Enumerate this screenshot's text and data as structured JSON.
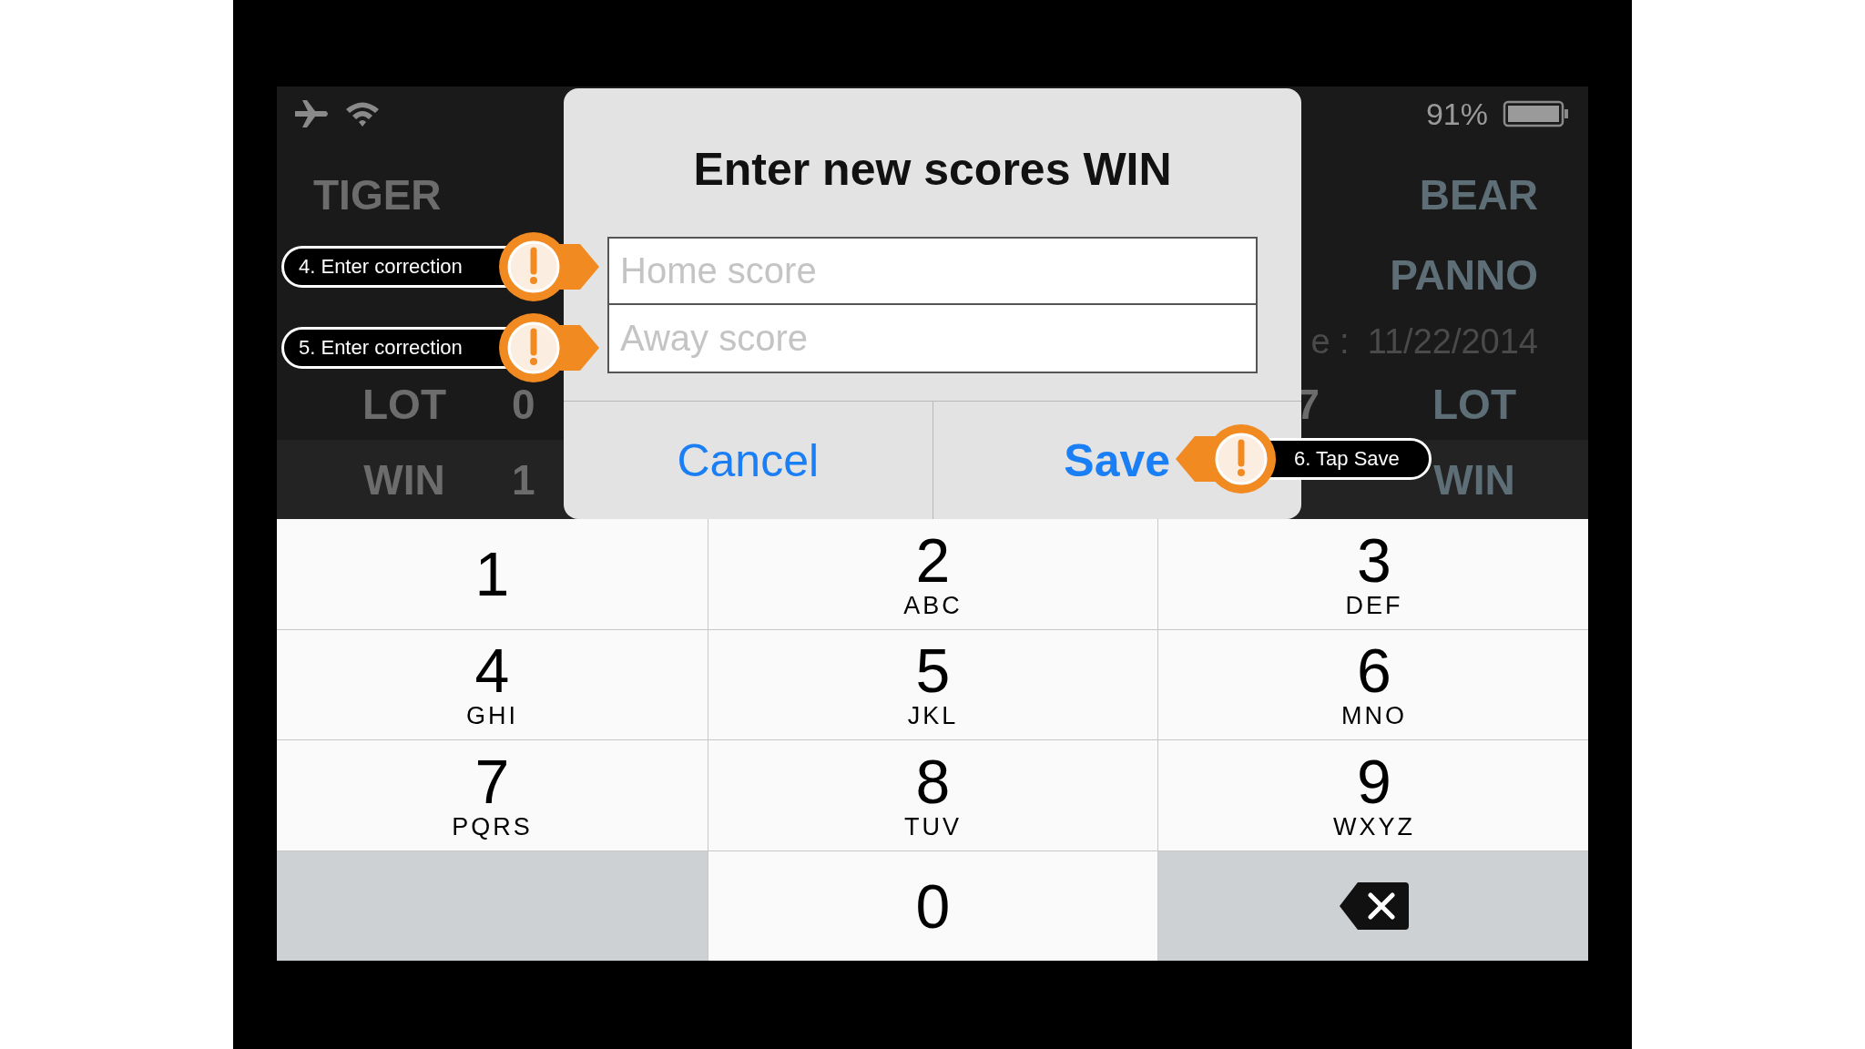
{
  "status_bar": {
    "battery_percent": "91%"
  },
  "scoreboard": {
    "left": {
      "team": "TIGER",
      "rows": [
        {
          "label": "LOT",
          "score": "0"
        },
        {
          "label": "WIN",
          "score": "1"
        }
      ]
    },
    "right": {
      "team": "BEAR",
      "subtitle": "PANNO",
      "date_label": "e :",
      "date": "11/22/2014",
      "rows": [
        {
          "label": "LOT",
          "score": "7"
        },
        {
          "label": "WIN"
        }
      ]
    }
  },
  "dialog": {
    "title": "Enter new scores WIN",
    "fields": [
      {
        "placeholder": "Home score"
      },
      {
        "placeholder": "Away score"
      }
    ],
    "buttons": [
      {
        "label": "Cancel",
        "kind": "cancel"
      },
      {
        "label": "Save",
        "kind": "save"
      }
    ]
  },
  "keypad": [
    {
      "kind": "digit",
      "digit": "1"
    },
    {
      "kind": "digit",
      "digit": "2",
      "letters": "ABC"
    },
    {
      "kind": "digit",
      "digit": "3",
      "letters": "DEF"
    },
    {
      "kind": "digit",
      "digit": "4",
      "letters": "GHI"
    },
    {
      "kind": "digit",
      "digit": "5",
      "letters": "JKL"
    },
    {
      "kind": "digit",
      "digit": "6",
      "letters": "MNO"
    },
    {
      "kind": "digit",
      "digit": "7",
      "letters": "PQRS"
    },
    {
      "kind": "digit",
      "digit": "8",
      "letters": "TUV"
    },
    {
      "kind": "digit",
      "digit": "9",
      "letters": "WXYZ"
    },
    {
      "kind": "blank"
    },
    {
      "kind": "digit",
      "digit": "0"
    },
    {
      "kind": "delete"
    }
  ],
  "callouts": [
    {
      "text": "4. Enter correction",
      "kind": "left"
    },
    {
      "text": "5. Enter correction",
      "kind": "left"
    },
    {
      "text": "6. Tap Save",
      "kind": "right"
    }
  ]
}
